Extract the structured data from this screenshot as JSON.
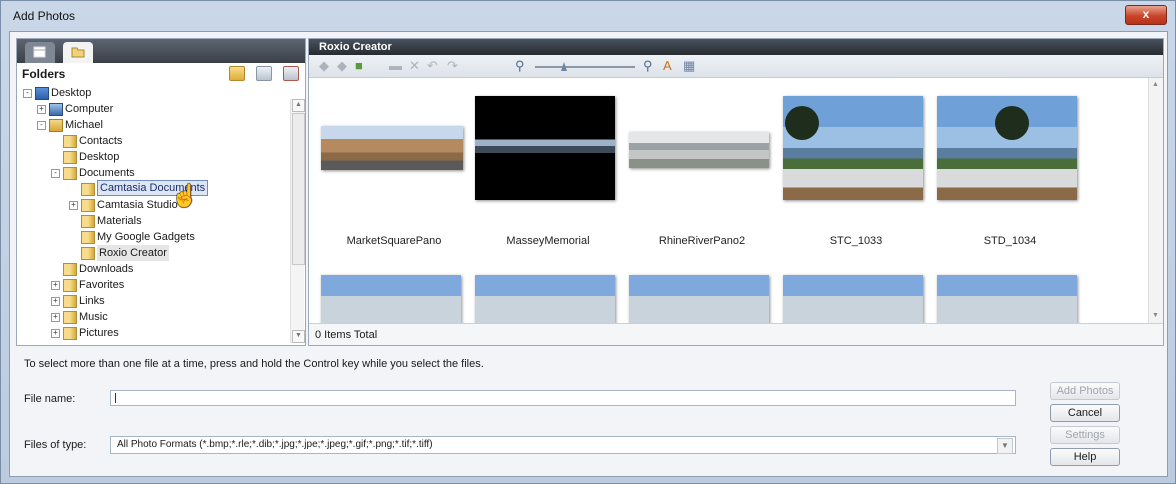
{
  "window": {
    "title": "Add Photos",
    "close_glyph": "x"
  },
  "left": {
    "folders_label": "Folders",
    "tree": [
      {
        "label": "Desktop",
        "level": 0,
        "expander": "-",
        "icon": "desktop-icon"
      },
      {
        "label": "Computer",
        "level": 1,
        "expander": "+",
        "icon": "computer-icon"
      },
      {
        "label": "Michael",
        "level": 1,
        "expander": "-",
        "icon": "user-folder-icon"
      },
      {
        "label": "Contacts",
        "level": 2,
        "expander": "",
        "icon": "folder-icon"
      },
      {
        "label": "Desktop",
        "level": 2,
        "expander": "",
        "icon": "folder-icon"
      },
      {
        "label": "Documents",
        "level": 2,
        "expander": "-",
        "icon": "folder-icon"
      },
      {
        "label": "Camtasia Documents",
        "level": 3,
        "expander": "",
        "icon": "folder-icon",
        "state": "hover"
      },
      {
        "label": "Camtasia Studio",
        "level": 3,
        "expander": "+",
        "icon": "folder-icon"
      },
      {
        "label": "Materials",
        "level": 3,
        "expander": "",
        "icon": "folder-icon"
      },
      {
        "label": "My Google Gadgets",
        "level": 3,
        "expander": "",
        "icon": "folder-icon"
      },
      {
        "label": "Roxio Creator",
        "level": 3,
        "expander": "",
        "icon": "folder-icon",
        "state": "selected"
      },
      {
        "label": "Downloads",
        "level": 2,
        "expander": "",
        "icon": "folder-icon"
      },
      {
        "label": "Favorites",
        "level": 2,
        "expander": "+",
        "icon": "folder-icon"
      },
      {
        "label": "Links",
        "level": 2,
        "expander": "+",
        "icon": "folder-icon"
      },
      {
        "label": "Music",
        "level": 2,
        "expander": "+",
        "icon": "folder-icon"
      },
      {
        "label": "Pictures",
        "level": 2,
        "expander": "+",
        "icon": "folder-icon"
      }
    ]
  },
  "right": {
    "title": "Roxio Creator",
    "status": "0 Items Total",
    "photos": [
      {
        "name": "MarketSquarePano",
        "kind": "pano-town"
      },
      {
        "name": "MasseyMemorial",
        "kind": "pano-dark"
      },
      {
        "name": "RhineRiverPano2",
        "kind": "pano-river"
      },
      {
        "name": "STC_1033",
        "kind": "tree-sea"
      },
      {
        "name": "STD_1034",
        "kind": "tree-sea"
      }
    ],
    "row2_count": 5
  },
  "bottom": {
    "hint": "To select more than one file at a time, press and hold the Control key while you select the files.",
    "file_name_label": "File name:",
    "file_name_value": "",
    "files_of_type_label": "Files of type:",
    "files_of_type_value": "All Photo Formats (*.bmp;*.rle;*.dib;*.jpg;*.jpe;*.jpeg;*.gif;*.png;*.tif;*.tiff)"
  },
  "buttons": {
    "add_photos": "Add Photos",
    "cancel": "Cancel",
    "settings": "Settings",
    "help": "Help"
  },
  "colors": {
    "selection": "#dde6f4",
    "titlebar_dark": "#262b31",
    "close_red": "#c9452a"
  }
}
